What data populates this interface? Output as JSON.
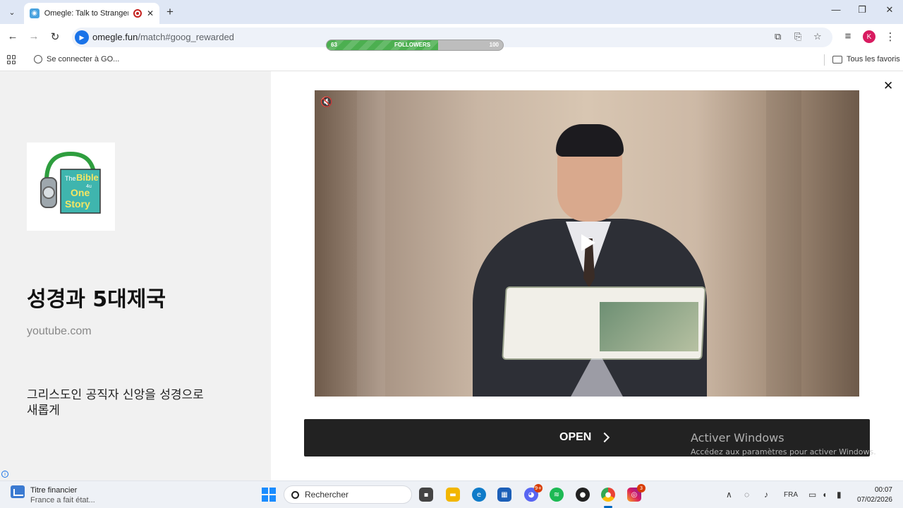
{
  "browser": {
    "tab_title": "Omegle: Talk to Strangers w",
    "tab_close": "✕",
    "new_tab": "+",
    "tab_menu": "⌄",
    "url_host": "omegle.fun",
    "url_path": "/match#goog_rewarded",
    "profile_initial": "K",
    "window_controls": {
      "minimize": "—",
      "maximize": "❐",
      "close": "✕"
    },
    "nav": {
      "back": "←",
      "forward": "→",
      "reload": "↻"
    },
    "toolbar_icons": {
      "translate": "⧉",
      "install": "⎘",
      "bookmark": "☆",
      "media": "≡",
      "menu": "⋮"
    }
  },
  "followers_bar": {
    "label": "FOLLOWERS",
    "current": "63",
    "max": "100",
    "progress": 0.63
  },
  "bookmarks": {
    "item": "Se connecter à GO...",
    "all": "Tous les favoris"
  },
  "ad": {
    "title": "성경과 5대제국",
    "domain": "youtube.com",
    "description": "그리스도인 공직자 신앙을 성경으로 새롭게",
    "close": "✕",
    "info": "i",
    "thumbnail_text": {
      "line1": "The",
      "line2": "Bible",
      "line3": "4u",
      "line4": "One",
      "line5": "Story"
    },
    "video": {
      "mute_icon": "🔇",
      "play_icon": "play-icon"
    },
    "open_label": "OPEN"
  },
  "watermark": {
    "title": "Activer Windows",
    "subtitle": "Accédez aux paramètres pour activer Windows."
  },
  "taskbar": {
    "weather_title": "Titre financier",
    "weather_sub": "France a fait état...",
    "search_placeholder": "Rechercher",
    "discord_badge": "9+",
    "instagram_badge": "3",
    "language": "FRA",
    "time": "00:07",
    "date": "07/02/2026"
  },
  "colors": {
    "accent": "#1a73e8",
    "followers_fill": "#4caf50",
    "open_bar": "#222222"
  }
}
